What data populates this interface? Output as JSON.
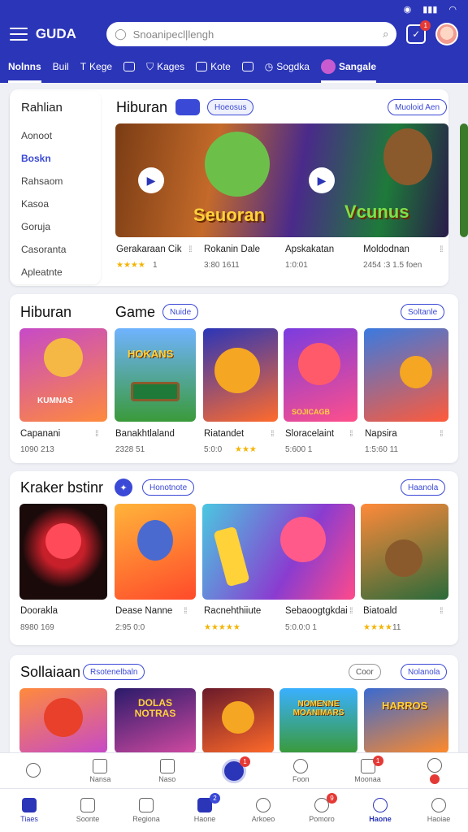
{
  "status": {
    "icons": [
      "circle-icon",
      "signal-icon",
      "wifi-icon"
    ]
  },
  "header": {
    "logo": "GUDA",
    "search_placeholder": "Snoanipecl|lengh",
    "notif_badge": "1"
  },
  "tabs": [
    {
      "label": "Nolnns",
      "icon": "none",
      "active": true
    },
    {
      "label": "Buil",
      "icon": "none"
    },
    {
      "label": "Kege",
      "icon": "T"
    },
    {
      "label": "",
      "icon": "square-icon"
    },
    {
      "label": "Kages",
      "icon": "shield-icon"
    },
    {
      "label": "Kote",
      "icon": "check-icon"
    },
    {
      "label": "",
      "icon": "image-icon"
    },
    {
      "label": "Sogdka",
      "icon": "clock-icon"
    },
    {
      "label": "Sangale",
      "icon": "avatar-icon"
    }
  ],
  "side_menu": {
    "title": "Rahlian",
    "items": [
      "Aonoot",
      "Boskn",
      "Rahsaom",
      "Kasoa",
      "Goruja",
      "Casoranta",
      "Apleatnte"
    ],
    "selected_index": 1
  },
  "section1": {
    "title": "Hiburan",
    "pill": "Hoeosus",
    "right_pill": "Muoloid Aen",
    "banners": [
      {
        "text": "Seuoran"
      },
      {
        "text": "Vcunus"
      }
    ],
    "items": [
      {
        "name": "Gerakaraan Cik",
        "sub": "",
        "rating": "★★★★",
        "sub2": "1"
      },
      {
        "name": "Rokanin Dale",
        "sub": "3:80 1611",
        "rating": ""
      },
      {
        "name": "Apskakatan",
        "sub": "1:0:01",
        "rating": ""
      },
      {
        "name": "Moldodnan",
        "sub": "2454 :3 1.5 foen",
        "rating": ""
      }
    ]
  },
  "section2": {
    "left_title": "Hiburan",
    "title": "Game",
    "pill": "Nuide",
    "right_pill": "Soltanle",
    "items": [
      {
        "name": "Capanani",
        "sub": "1090 213",
        "art": "KUMNAS"
      },
      {
        "name": "Banakhtlaland",
        "sub": "2328 51",
        "art": "HOKANS"
      },
      {
        "name": "Riatandet",
        "sub": "5:0:0",
        "rating": "★★★",
        "art": ""
      },
      {
        "name": "Sloracelaint",
        "sub": "5:600 1",
        "art": "SOJICAGB"
      },
      {
        "name": "Napsira",
        "sub": "1:5:60 11",
        "art": ""
      }
    ]
  },
  "section3": {
    "title": "Kraker bstinr",
    "pill": "Honotnote",
    "right_pill": "Haanola",
    "items": [
      {
        "name": "Doorakla",
        "sub": "8980 169"
      },
      {
        "name": "Dease Nanne",
        "sub": "2:95 0:0"
      },
      {
        "name": "Racnehthiiute",
        "sub": "",
        "rating": "★★★★★"
      },
      {
        "name": "Sebaoogtgkdai",
        "sub": "5:0.0:0 1"
      },
      {
        "name": "Biatoald",
        "sub": "11",
        "rating": "★★★★"
      }
    ]
  },
  "section4": {
    "title": "Sollaiaan",
    "pill": "Rsotenelbaln",
    "pill2": "Coor",
    "right_pill": "Nolanola",
    "arts": [
      "",
      "DOLAS NOTRAS",
      "",
      "NOMENNE MOANIMARS",
      "HARROS"
    ]
  },
  "bottom_bar1": [
    {
      "label": "",
      "icon": "clock-icon"
    },
    {
      "label": "Nansa",
      "icon": "list-icon"
    },
    {
      "label": "Naso",
      "icon": "box-icon"
    },
    {
      "label": "",
      "icon": "record-icon",
      "badge": "1"
    },
    {
      "label": "Foon",
      "icon": "face-icon"
    },
    {
      "label": "Moonaa",
      "icon": "message-icon",
      "badge": "1"
    },
    {
      "label": "",
      "icon": "play-icon"
    }
  ],
  "bottom_bar2": [
    {
      "label": "Tiaes",
      "icon": "home-icon",
      "active": true
    },
    {
      "label": "Soonte",
      "icon": "calendar-icon"
    },
    {
      "label": "Regiona",
      "icon": "card-icon"
    },
    {
      "label": "Haone",
      "icon": "media-icon",
      "badge": "2"
    },
    {
      "label": "Arkoeo",
      "icon": "face-icon"
    },
    {
      "label": "Pomoro",
      "icon": "shield-icon",
      "badge": "9"
    },
    {
      "label": "Haone",
      "icon": "person-icon"
    },
    {
      "label": "Haoiae",
      "icon": "user-icon"
    }
  ],
  "colors": {
    "primary": "#2b35b8",
    "accent": "#3a49d6",
    "star": "#f4b400"
  }
}
